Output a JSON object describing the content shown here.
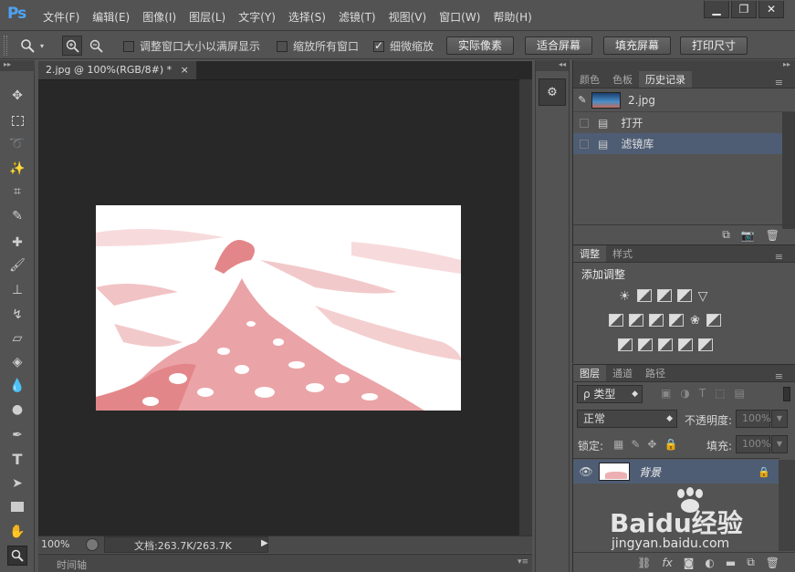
{
  "app": {
    "logo": "Ps"
  },
  "menu": [
    "文件(F)",
    "编辑(E)",
    "图像(I)",
    "图层(L)",
    "文字(Y)",
    "选择(S)",
    "滤镜(T)",
    "视图(V)",
    "窗口(W)",
    "帮助(H)"
  ],
  "window_buttons": {
    "minimize": "▁",
    "restore": "❐",
    "close": "✕"
  },
  "options": {
    "resize_windows_label": "调整窗口大小以满屏显示",
    "zoom_all_label": "缩放所有窗口",
    "scrubby_zoom_label": "细微缩放",
    "scrubby_zoom_checked": true,
    "actual_pixels": "实际像素",
    "fit_screen": "适合屏幕",
    "fill_screen": "填充屏幕",
    "print_size": "打印尺寸"
  },
  "document": {
    "tab_title": "2.jpg @ 100%(RGB/8#) *",
    "tab_close": "×",
    "zoom": "100%",
    "doc_info": "文档:263.7K/263.7K"
  },
  "timeline_label": "时间轴",
  "history_panel": {
    "tabs": [
      "颜色",
      "色板",
      "历史记录"
    ],
    "active_tab": 2,
    "snapshot_name": "2.jpg",
    "items": [
      "打开",
      "滤镜库"
    ],
    "selected_index": 1
  },
  "adjust_panel": {
    "tabs": [
      "调整",
      "样式"
    ],
    "active_tab": 0,
    "heading": "添加调整"
  },
  "layers_panel": {
    "tabs": [
      "图层",
      "通道",
      "路径"
    ],
    "active_tab": 0,
    "filter_label": "ρ 类型",
    "blend_mode": "正常",
    "opacity_label": "不透明度:",
    "opacity_value": "100%",
    "lock_label": "锁定:",
    "fill_label": "填充:",
    "fill_value": "100%",
    "layers": [
      {
        "name": "背景",
        "visible": true,
        "locked": true
      }
    ],
    "fx_label": "fx"
  },
  "watermark": {
    "brand": "Baidu经验",
    "url": "jingyan.baidu.com"
  },
  "colors": {
    "ui_bg": "#535353",
    "canvas_bg": "#282828",
    "selection": "#4e5d74",
    "ps_blue": "#4ea2f1",
    "filter_red": "#e07a7e"
  }
}
